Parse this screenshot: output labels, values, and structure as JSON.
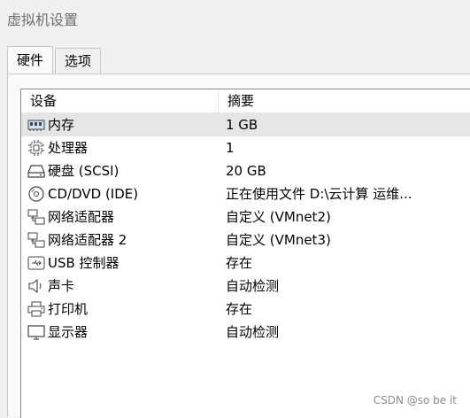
{
  "window": {
    "title": "虚拟机设置"
  },
  "tabs": [
    {
      "label": "硬件",
      "active": true
    },
    {
      "label": "选项",
      "active": false
    }
  ],
  "table": {
    "headers": {
      "device": "设备",
      "summary": "摘要"
    },
    "rows": [
      {
        "icon": "memory-icon",
        "device": "内存",
        "summary": "1 GB",
        "selected": true
      },
      {
        "icon": "processor-icon",
        "device": "处理器",
        "summary": "1",
        "selected": false
      },
      {
        "icon": "hard-disk-icon",
        "device": "硬盘 (SCSI)",
        "summary": "20 GB",
        "selected": false
      },
      {
        "icon": "cd-dvd-icon",
        "device": "CD/DVD (IDE)",
        "summary": "正在使用文件 D:\\云计算 运维...",
        "selected": false
      },
      {
        "icon": "network-adapter-icon",
        "device": "网络适配器",
        "summary": "自定义 (VMnet2)",
        "selected": false
      },
      {
        "icon": "network-adapter-icon",
        "device": "网络适配器 2",
        "summary": "自定义 (VMnet3)",
        "selected": false
      },
      {
        "icon": "usb-controller-icon",
        "device": "USB 控制器",
        "summary": "存在",
        "selected": false
      },
      {
        "icon": "sound-card-icon",
        "device": "声卡",
        "summary": "自动检测",
        "selected": false
      },
      {
        "icon": "printer-icon",
        "device": "打印机",
        "summary": "存在",
        "selected": false
      },
      {
        "icon": "display-icon",
        "device": "显示器",
        "summary": "自动检测",
        "selected": false
      }
    ]
  },
  "watermark": "CSDN @so be it",
  "colors": {
    "background": "#f0f0f0",
    "selected_row": "#e5e5e5",
    "title_text": "#6e6e6e",
    "icon_stroke": "#444444"
  }
}
